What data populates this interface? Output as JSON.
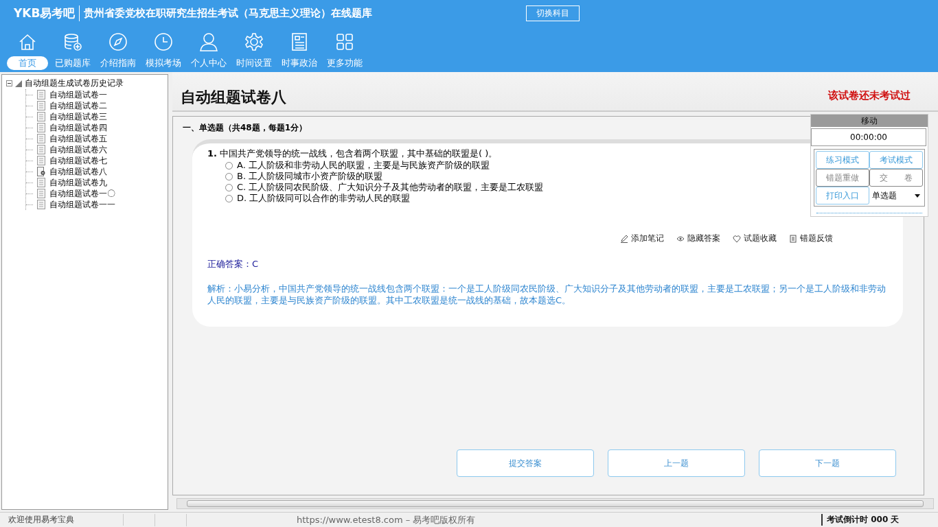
{
  "header": {
    "logo": "YKB易考吧",
    "title": "贵州省委党校在职研究生招生考试（马克思主义理论）在线题库",
    "switch_button": "切换科目"
  },
  "nav": [
    {
      "label": "首页",
      "selected": true
    },
    {
      "label": "已购题库",
      "selected": false
    },
    {
      "label": "介绍指南",
      "selected": false
    },
    {
      "label": "模拟考场",
      "selected": false
    },
    {
      "label": "个人中心",
      "selected": false
    },
    {
      "label": "时间设置",
      "selected": false
    },
    {
      "label": "时事政治",
      "selected": false
    },
    {
      "label": "更多功能",
      "selected": false
    }
  ],
  "tree": {
    "label": "自动组题生成试卷历史记录",
    "expanded": true,
    "children": [
      {
        "label": "自动组题试卷一",
        "kind": "doc"
      },
      {
        "label": "自动组题试卷二",
        "kind": "doc"
      },
      {
        "label": "自动组题试卷三",
        "kind": "doc"
      },
      {
        "label": "自动组题试卷四",
        "kind": "doc"
      },
      {
        "label": "自动组题试卷五",
        "kind": "doc"
      },
      {
        "label": "自动组题试卷六",
        "kind": "doc"
      },
      {
        "label": "自动组题试卷七",
        "kind": "doc"
      },
      {
        "label": "自动组题试卷八",
        "kind": "current"
      },
      {
        "label": "自动组题试卷九",
        "kind": "doc"
      },
      {
        "label": "自动组题试卷一〇",
        "kind": "doc"
      },
      {
        "label": "自动组题试卷一一",
        "kind": "doc"
      }
    ]
  },
  "paper": {
    "title": "自动组题试卷八",
    "status": "该试卷还未考试过",
    "section": "一、单选题（共48题，每题1分）"
  },
  "question": {
    "number": "1.",
    "text": "中国共产党领导的统一战线，包含着两个联盟，其中基础的联盟是( )。",
    "options": [
      {
        "label": "A. 工人阶级和非劳动人民的联盟，主要是与民族资产阶级的联盟",
        "selected": false
      },
      {
        "label": "B. 工人阶级同城市小资产阶级的联盟",
        "selected": false
      },
      {
        "label": "C. 工人阶级同农民阶级、广大知识分子及其他劳动者的联盟，主要是工农联盟",
        "selected": false
      },
      {
        "label": "D. 工人阶级同可以合作的非劳动人民的联盟",
        "selected": false
      }
    ],
    "actions": [
      "添加笔记",
      "隐藏答案",
      "试题收藏",
      "错题反馈"
    ],
    "answer": "正确答案：C",
    "analysis": "解析：小易分析，中国共产党领导的统一战线包含两个联盟：一个是工人阶级同农民阶级、广大知识分子及其他劳动者的联盟，主要是工农联盟；另一个是工人阶级和非劳动人民的联盟，主要是与民族资产阶级的联盟。其中工农联盟是统一战线的基础，故本题选C。"
  },
  "bottom_buttons": [
    "提交答案",
    "上一题",
    "下一题"
  ],
  "side_panel": {
    "move": "移动",
    "timer": "00:00:00",
    "buttons": [
      {
        "label": "练习模式",
        "disabled": false
      },
      {
        "label": "考试模式",
        "disabled": false
      },
      {
        "label": "错题重做",
        "disabled": true
      },
      {
        "label": "交　　卷",
        "disabled": true
      },
      {
        "label": "打印入口",
        "disabled": false
      }
    ],
    "type_select": "单选题"
  },
  "status_bar": {
    "welcome": "欢迎使用易考宝典",
    "copyright": "https://www.etest8.com – 易考吧版权所有",
    "countdown": "考试倒计时 000 天"
  }
}
